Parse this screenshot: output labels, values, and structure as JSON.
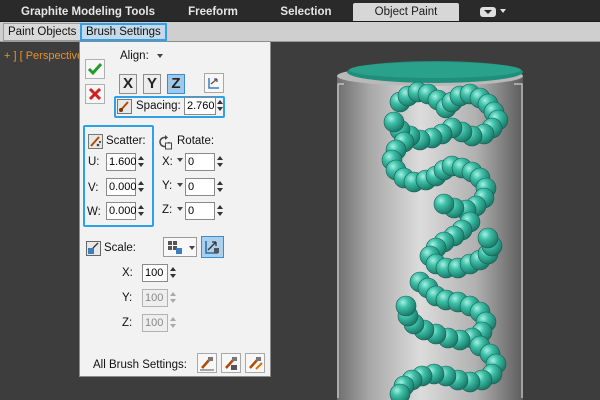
{
  "ribbon": {
    "tabs": [
      {
        "label": "Graphite Modeling Tools",
        "active": false
      },
      {
        "label": "Freeform",
        "active": false
      },
      {
        "label": "Selection",
        "active": false
      },
      {
        "label": "Object Paint",
        "active": true
      }
    ]
  },
  "subpanel": {
    "paint_objects": "Paint Objects",
    "brush_settings": "Brush Settings"
  },
  "viewport": {
    "label": "+ ] [ Perspective"
  },
  "brush_panel": {
    "align_label": "Align:",
    "axes": [
      "X",
      "Y",
      "Z"
    ],
    "active_axis": "Z",
    "spacing": {
      "label": "Spacing:",
      "value": "2.760"
    },
    "scatter": {
      "label": "Scatter:",
      "u": {
        "label": "U:",
        "value": "1.600"
      },
      "v": {
        "label": "V:",
        "value": "0.000"
      },
      "w": {
        "label": "W:",
        "value": "0.000"
      }
    },
    "rotate": {
      "label": "Rotate:",
      "x": {
        "label": "X:",
        "value": "0"
      },
      "y": {
        "label": "Y:",
        "value": "0"
      },
      "z": {
        "label": "Z:",
        "value": "0"
      }
    },
    "scale": {
      "label": "Scale:",
      "x": {
        "label": "X:",
        "value": "100"
      },
      "y": {
        "label": "Y:",
        "value": "100"
      },
      "z": {
        "label": "Z:",
        "value": "100"
      }
    },
    "all_brush_settings": "All Brush Settings:"
  },
  "colors": {
    "accent_highlight": "#2ea0e6",
    "ok_green": "#1f9c2a",
    "cancel_red": "#d21e1e",
    "viewport_label": "#e6922a",
    "sphere_teal": "#3fc1aa",
    "cylinder_gray": "#b8b8b8"
  }
}
